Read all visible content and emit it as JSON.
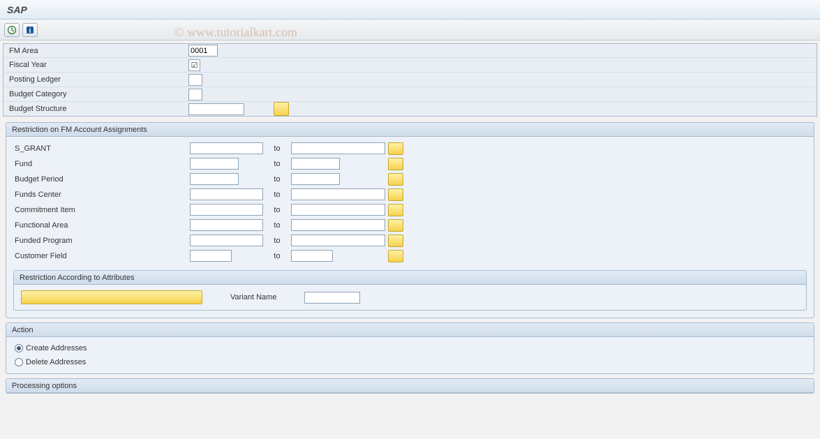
{
  "watermark": "© www.tutorialkart.com",
  "title": "SAP",
  "top_fields": {
    "fm_area": {
      "label": "FM Area",
      "value": "0001"
    },
    "fiscal_year": {
      "label": "Fiscal Year",
      "checked": true
    },
    "posting_ledger": {
      "label": "Posting Ledger",
      "value": ""
    },
    "budget_category": {
      "label": "Budget Category",
      "value": ""
    },
    "budget_structure": {
      "label": "Budget Structure",
      "value": ""
    }
  },
  "restriction_group": {
    "title": "Restriction on FM Account Assignments",
    "to_label": "to",
    "rows": [
      {
        "label": "S_GRANT"
      },
      {
        "label": "Fund"
      },
      {
        "label": "Budget Period"
      },
      {
        "label": "Funds Center"
      },
      {
        "label": "Commitment Item"
      },
      {
        "label": "Functional Area"
      },
      {
        "label": "Funded Program"
      },
      {
        "label": "Customer Field"
      }
    ],
    "attributes": {
      "title": "Restriction According to Attributes",
      "variant_label": "Variant Name"
    }
  },
  "action_group": {
    "title": "Action",
    "options": [
      {
        "label": "Create Addresses",
        "checked": true
      },
      {
        "label": "Delete Addresses",
        "checked": false
      }
    ]
  },
  "processing_group": {
    "title": "Processing options"
  }
}
